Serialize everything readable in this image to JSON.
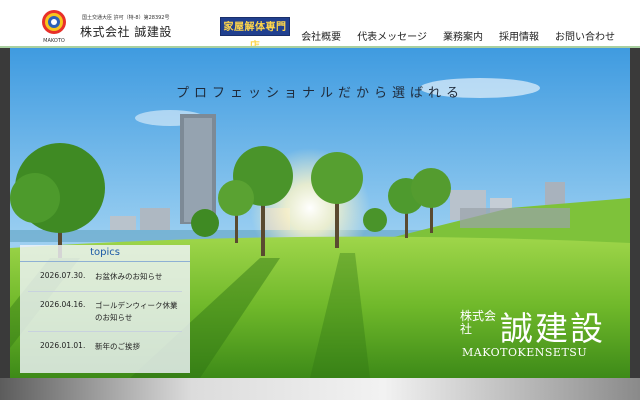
{
  "header": {
    "logo_text": "MAKOTO",
    "license": "国土交通大臣 許可（特-8）第28392号",
    "company": "株式会社 誠建設",
    "badge": "家屋解体専門店"
  },
  "nav": [
    {
      "label": "会社概要"
    },
    {
      "label": "代表メッセージ"
    },
    {
      "label": "業務案内"
    },
    {
      "label": "採用情報"
    },
    {
      "label": "お問い合わせ"
    }
  ],
  "hero": {
    "tagline": "プロフェッショナルだから選ばれる",
    "brand_small": "株式会社",
    "brand_big": "誠建設",
    "brand_en": "MAKOTOKENSETSU"
  },
  "topics": {
    "title": "topics",
    "items": [
      {
        "date": "2026.07.30.",
        "title": "お盆休みのお知らせ"
      },
      {
        "date": "2026.04.16.",
        "title": "ゴールデンウィーク休業のお知らせ"
      },
      {
        "date": "2026.01.01.",
        "title": "新年のご挨拶"
      }
    ]
  },
  "colors": {
    "badge_bg": "#21408f",
    "badge_text": "#ffd64a",
    "topics_title": "#1c5aa6",
    "divider": "#a9d0a0"
  }
}
